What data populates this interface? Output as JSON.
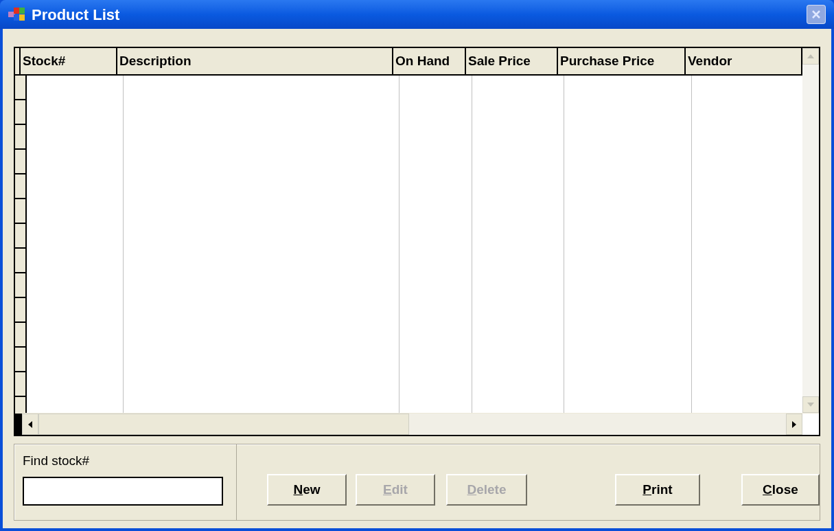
{
  "window": {
    "title": "Product List"
  },
  "table": {
    "columns": [
      {
        "label": "Stock#"
      },
      {
        "label": "Description"
      },
      {
        "label": "On Hand"
      },
      {
        "label": "Sale Price"
      },
      {
        "label": "Purchase Price"
      },
      {
        "label": "Vendor"
      }
    ]
  },
  "find": {
    "label": "Find stock#"
  },
  "buttons": [
    {
      "label": "New",
      "disabled": false
    },
    {
      "label": "Edit",
      "disabled": true
    },
    {
      "label": "Delete",
      "disabled": true
    },
    {
      "label": "Print",
      "disabled": false
    },
    {
      "label": "Close",
      "disabled": false
    }
  ]
}
